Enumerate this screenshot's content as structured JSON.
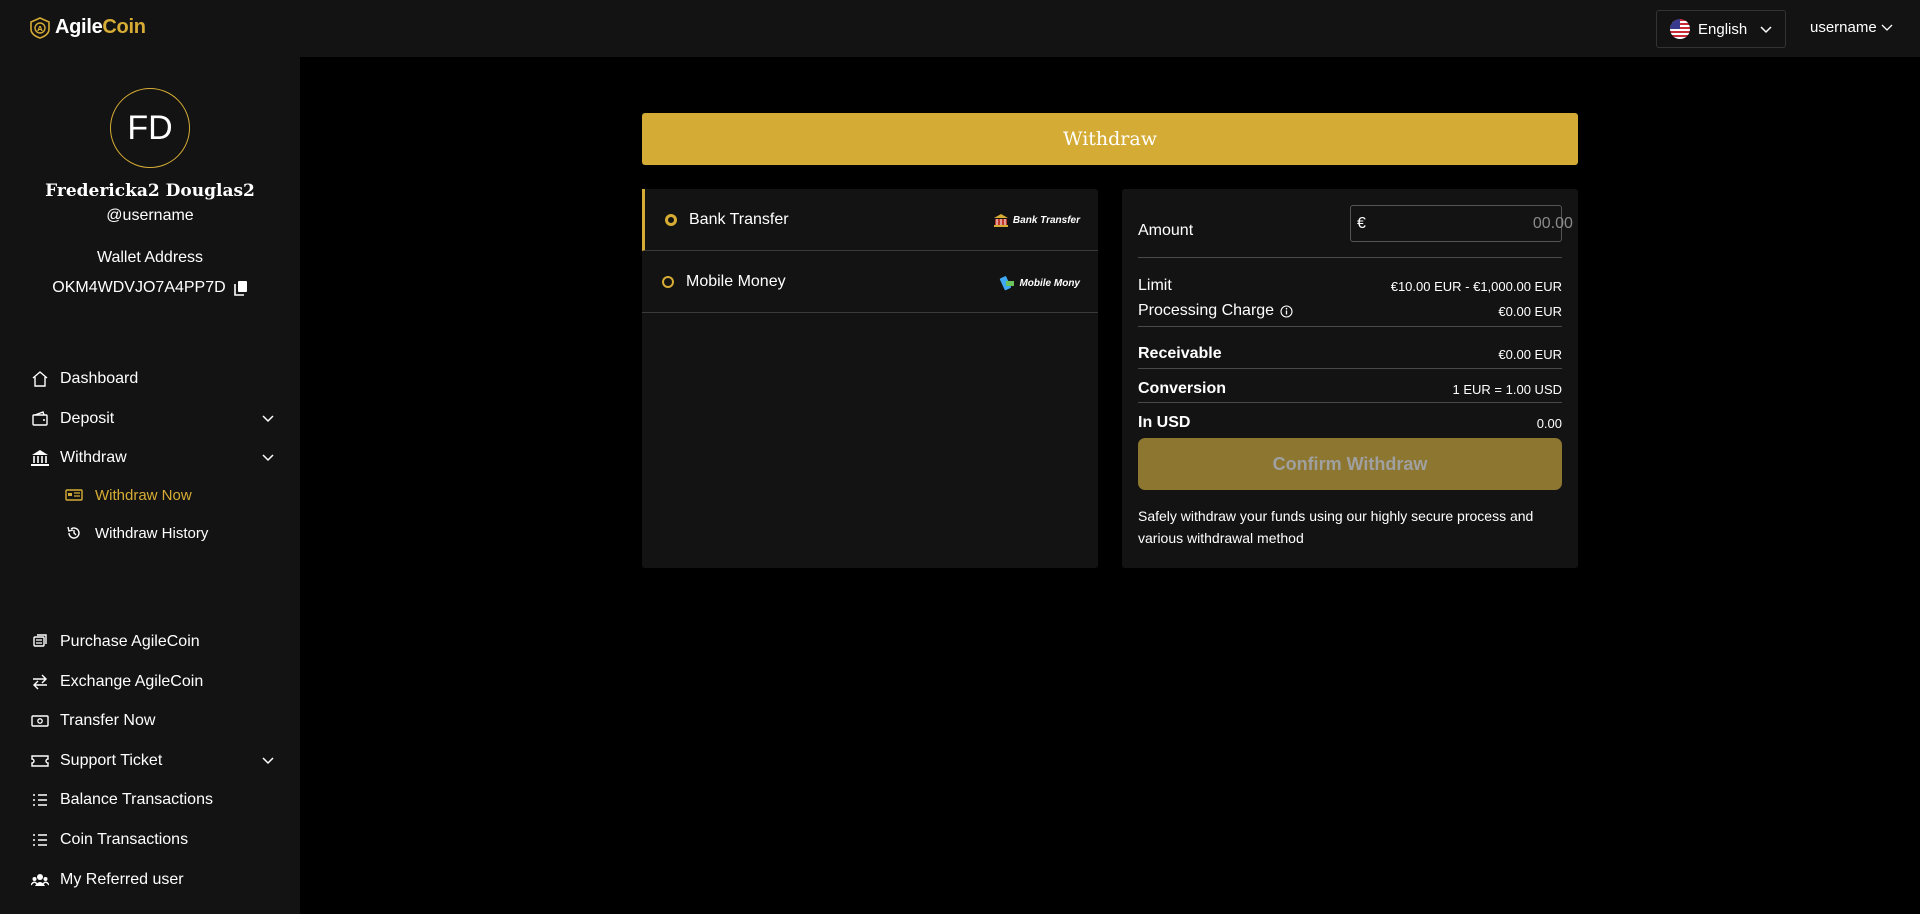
{
  "brand": {
    "name_part1": "Agile",
    "name_part2": "Coin",
    "accent": "#d6ac35"
  },
  "header": {
    "language": "English",
    "user": "username"
  },
  "profile": {
    "initials": "FD",
    "full_name": "Fredericka2 Douglas2",
    "handle": "@username",
    "wallet_label": "Wallet Address",
    "wallet_address": "OKM4WDVJO7A4PP7D"
  },
  "nav": {
    "dashboard": "Dashboard",
    "deposit": "Deposit",
    "withdraw": "Withdraw",
    "withdraw_now": "Withdraw Now",
    "withdraw_history": "Withdraw History",
    "purchase": "Purchase AgileCoin",
    "exchange": "Exchange AgileCoin",
    "transfer": "Transfer Now",
    "support": "Support Ticket",
    "balance_tx": "Balance Transactions",
    "coin_tx": "Coin Transactions",
    "referred": "My Referred user"
  },
  "page": {
    "title": "Withdraw"
  },
  "methods": [
    {
      "name": "Bank Transfer",
      "logo_text": "Bank Transfer",
      "selected": true
    },
    {
      "name": "Mobile Money",
      "logo_text": "Mobile Mony",
      "selected": false
    }
  ],
  "summary": {
    "amount_label": "Amount",
    "currency_symbol": "€",
    "amount_placeholder": "00.00",
    "limit_label": "Limit",
    "limit_value": "€10.00 EUR - €1,000.00 EUR",
    "charge_label": "Processing Charge",
    "charge_value": "€0.00 EUR",
    "receivable_label": "Receivable",
    "receivable_value": "€0.00 EUR",
    "conversion_label": "Conversion",
    "conversion_value": "1 EUR = 1.00 USD",
    "in_usd_label": "In USD",
    "in_usd_value": "0.00",
    "confirm_label": "Confirm Withdraw",
    "note": "Safely withdraw your funds using our highly secure process and various withdrawal method"
  }
}
